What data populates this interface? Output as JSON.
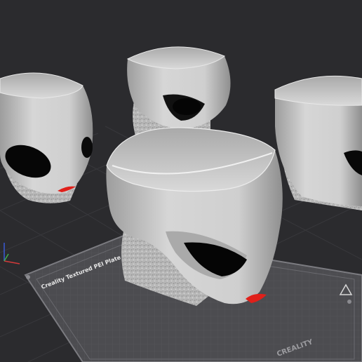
{
  "app": {
    "name": "3D slicer viewport"
  },
  "build_plate": {
    "label": "Creality Textured PEI Plate",
    "brand": "CREALITY"
  },
  "models": [
    {
      "name": "alien-head-planter-left"
    },
    {
      "name": "alien-head-planter-back"
    },
    {
      "name": "alien-head-planter-right"
    },
    {
      "name": "alien-head-planter-front"
    }
  ],
  "colors": {
    "background": "#2b2b2e",
    "grid_line": "#3c3c40",
    "plate": "#4a4a4e",
    "plate_edge": "#77777b",
    "model": "#c6c6c6",
    "model_shadow": "#8a8a8a",
    "eye": "#050505",
    "lips": "#e0201a",
    "support": "#b9b9b9",
    "axis_x": "#d33a3a",
    "axis_y": "#3fae4d",
    "axis_z": "#3b5bd6"
  }
}
